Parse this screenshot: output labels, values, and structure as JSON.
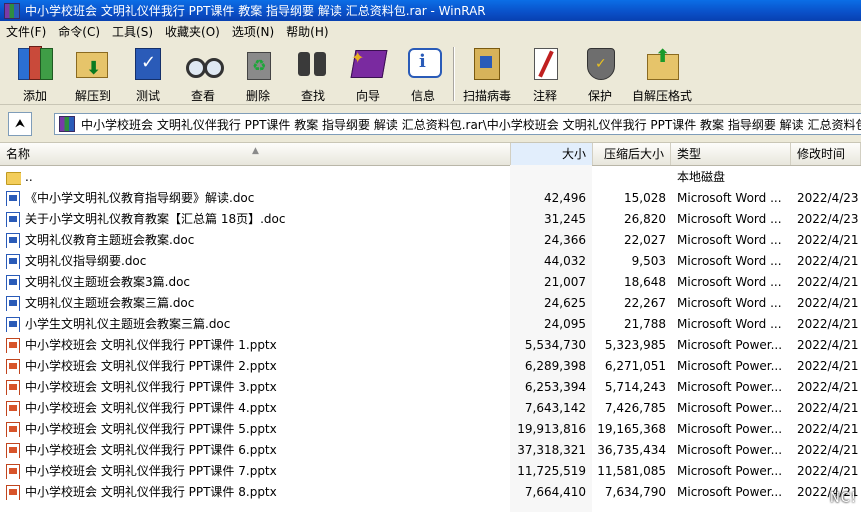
{
  "window": {
    "title": "中小学校班会 文明礼仪伴我行 PPT课件 教案 指导纲要 解读 汇总资料包.rar - WinRAR"
  },
  "menu": [
    "文件(F)",
    "命令(C)",
    "工具(S)",
    "收藏夹(O)",
    "选项(N)",
    "帮助(H)"
  ],
  "toolbar": [
    {
      "label": "添加",
      "icon": "add-archive-icon"
    },
    {
      "label": "解压到",
      "icon": "extract-to-icon"
    },
    {
      "label": "测试",
      "icon": "test-icon"
    },
    {
      "label": "查看",
      "icon": "view-icon"
    },
    {
      "label": "删除",
      "icon": "delete-icon"
    },
    {
      "label": "查找",
      "icon": "find-icon"
    },
    {
      "label": "向导",
      "icon": "wizard-icon"
    },
    {
      "label": "信息",
      "icon": "info-icon"
    },
    {
      "label": "扫描病毒",
      "icon": "virus-scan-icon"
    },
    {
      "label": "注释",
      "icon": "comment-icon"
    },
    {
      "label": "保护",
      "icon": "protect-icon"
    },
    {
      "label": "自解压格式",
      "icon": "sfx-icon"
    }
  ],
  "address": {
    "path": "中小学校班会 文明礼仪伴我行 PPT课件 教案 指导纲要 解读 汇总资料包.rar\\中小学校班会 文明礼仪伴我行 PPT课件 教案 指导纲要 解读 汇总资料包"
  },
  "columns": {
    "name": "名称",
    "size": "大小",
    "packed": "压缩后大小",
    "type": "类型",
    "modified": "修改时间"
  },
  "files": [
    {
      "icon": "folder",
      "name": "..",
      "size": "",
      "packed": "",
      "type": "本地磁盘",
      "modified": ""
    },
    {
      "icon": "doc",
      "name": "《中小学文明礼仪教育指导纲要》解读.doc",
      "size": "42,496",
      "packed": "15,028",
      "type": "Microsoft Word ...",
      "modified": "2022/4/23"
    },
    {
      "icon": "doc",
      "name": "关于小学文明礼仪教育教案【汇总篇 18页】.doc",
      "size": "31,245",
      "packed": "26,820",
      "type": "Microsoft Word ...",
      "modified": "2022/4/23"
    },
    {
      "icon": "doc",
      "name": "文明礼仪教育主题班会教案.doc",
      "size": "24,366",
      "packed": "22,027",
      "type": "Microsoft Word ...",
      "modified": "2022/4/21"
    },
    {
      "icon": "doc",
      "name": "文明礼仪指导纲要.doc",
      "size": "44,032",
      "packed": "9,503",
      "type": "Microsoft Word ...",
      "modified": "2022/4/21"
    },
    {
      "icon": "doc",
      "name": "文明礼仪主题班会教案3篇.doc",
      "size": "21,007",
      "packed": "18,648",
      "type": "Microsoft Word ...",
      "modified": "2022/4/21"
    },
    {
      "icon": "doc",
      "name": "文明礼仪主题班会教案三篇.doc",
      "size": "24,625",
      "packed": "22,267",
      "type": "Microsoft Word ...",
      "modified": "2022/4/21"
    },
    {
      "icon": "doc",
      "name": "小学生文明礼仪主题班会教案三篇.doc",
      "size": "24,095",
      "packed": "21,788",
      "type": "Microsoft Word ...",
      "modified": "2022/4/21"
    },
    {
      "icon": "ppt",
      "name": "中小学校班会 文明礼仪伴我行 PPT课件 1.pptx",
      "size": "5,534,730",
      "packed": "5,323,985",
      "type": "Microsoft Power...",
      "modified": "2022/4/21"
    },
    {
      "icon": "ppt",
      "name": "中小学校班会 文明礼仪伴我行 PPT课件 2.pptx",
      "size": "6,289,398",
      "packed": "6,271,051",
      "type": "Microsoft Power...",
      "modified": "2022/4/21"
    },
    {
      "icon": "ppt",
      "name": "中小学校班会 文明礼仪伴我行 PPT课件 3.pptx",
      "size": "6,253,394",
      "packed": "5,714,243",
      "type": "Microsoft Power...",
      "modified": "2022/4/21"
    },
    {
      "icon": "ppt",
      "name": "中小学校班会 文明礼仪伴我行 PPT课件 4.pptx",
      "size": "7,643,142",
      "packed": "7,426,785",
      "type": "Microsoft Power...",
      "modified": "2022/4/21"
    },
    {
      "icon": "ppt",
      "name": "中小学校班会 文明礼仪伴我行 PPT课件 5.pptx",
      "size": "19,913,816",
      "packed": "19,165,368",
      "type": "Microsoft Power...",
      "modified": "2022/4/21"
    },
    {
      "icon": "ppt",
      "name": "中小学校班会 文明礼仪伴我行 PPT课件 6.pptx",
      "size": "37,318,321",
      "packed": "36,735,434",
      "type": "Microsoft Power...",
      "modified": "2022/4/21"
    },
    {
      "icon": "ppt",
      "name": "中小学校班会 文明礼仪伴我行 PPT课件 7.pptx",
      "size": "11,725,519",
      "packed": "11,581,085",
      "type": "Microsoft Power...",
      "modified": "2022/4/21"
    },
    {
      "icon": "ppt",
      "name": "中小学校班会 文明礼仪伴我行 PPT课件 8.pptx",
      "size": "7,664,410",
      "packed": "7,634,790",
      "type": "Microsoft Power...",
      "modified": "2022/4/21"
    }
  ],
  "watermark": "NC!"
}
